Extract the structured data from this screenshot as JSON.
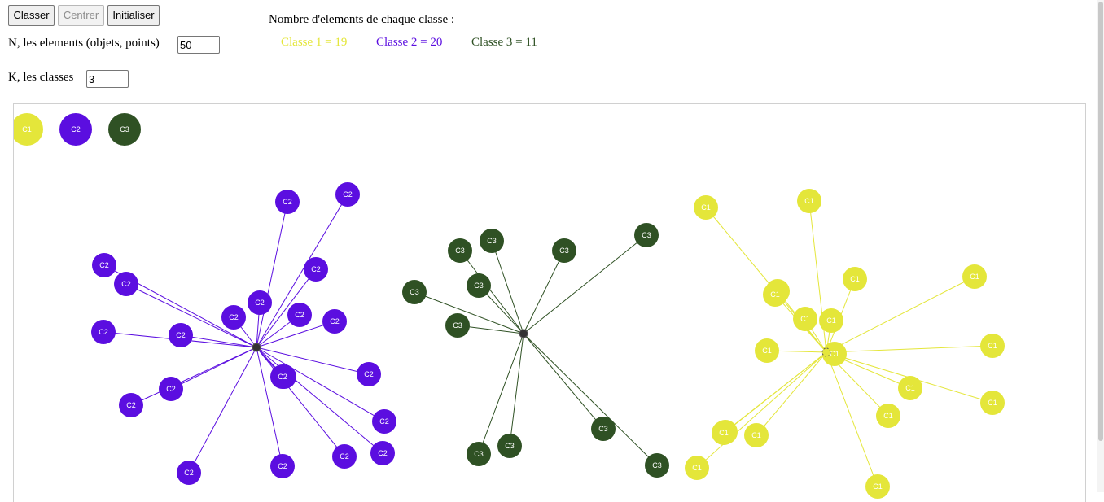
{
  "toolbar": {
    "classify_label": "Classer",
    "center_label": "Centrer",
    "reset_label": "Initialiser"
  },
  "form": {
    "n_label": "N, les elements (objets, points)",
    "n_value": "50",
    "k_label": "K, les classes",
    "k_value": "3"
  },
  "summary": {
    "title": "Nombre d'elements de chaque classe :",
    "counts": [
      {
        "text": "Classe 1 = 19",
        "color": "#e4e63a"
      },
      {
        "text": "Classe 2 = 20",
        "color": "#5b0ee0"
      },
      {
        "text": "Classe 3 = 11",
        "color": "#2f5124"
      }
    ]
  },
  "classes": [
    {
      "label": "C1",
      "color": "#e4e63a"
    },
    {
      "label": "C2",
      "color": "#5b0ee0"
    },
    {
      "label": "C3",
      "color": "#2f5124"
    }
  ]
}
